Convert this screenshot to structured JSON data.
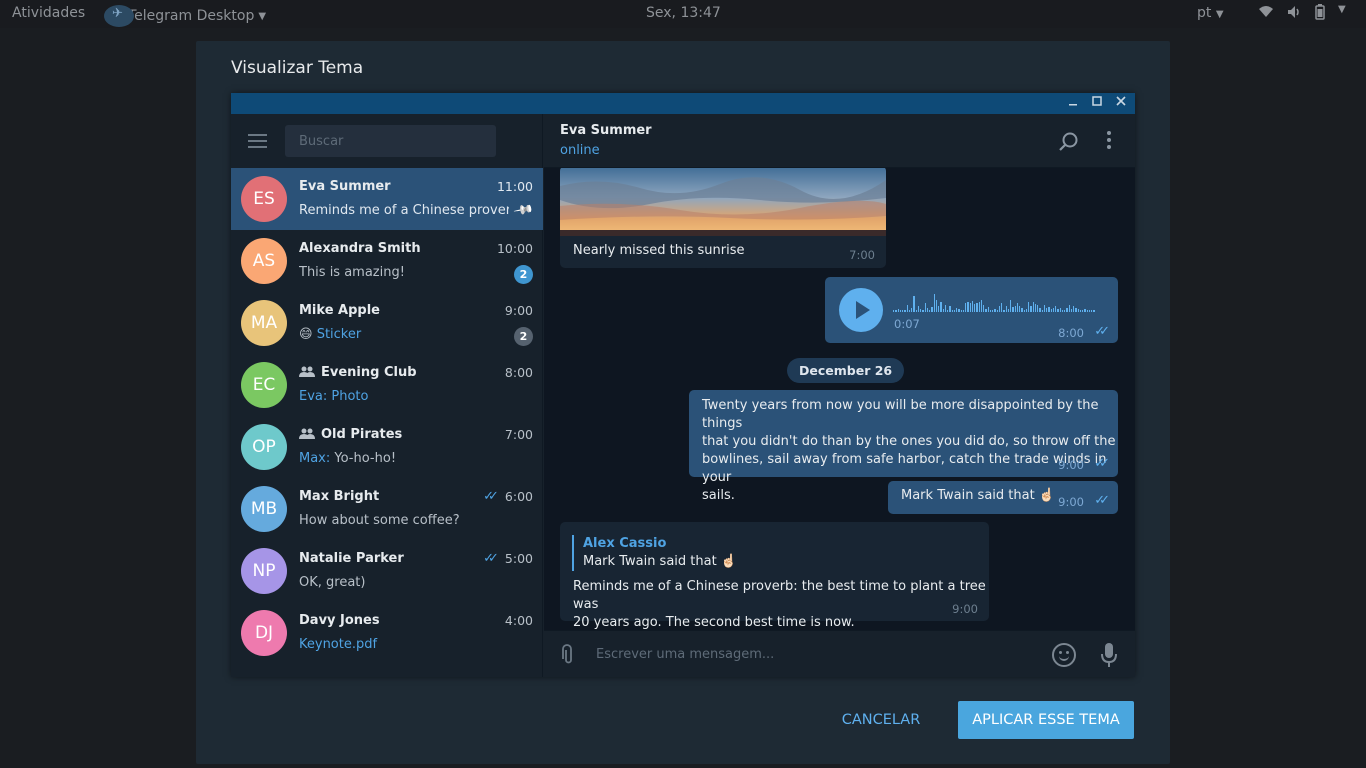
{
  "topbar": {
    "activities": "Atividades",
    "app_name": "Telegram Desktop",
    "clock": "Sex, 13:47",
    "lang": "pt"
  },
  "dialog": {
    "title": "Visualizar Tema",
    "cancel": "CANCELAR",
    "apply": "APLICAR ESSE TEMA"
  },
  "preview": {
    "search_placeholder": "Buscar",
    "chats": [
      {
        "initials": "ES",
        "name": "Eva Summer",
        "time": "11:00",
        "preview": "Reminds me of a Chinese proverb...",
        "color": "#e17076",
        "pinned": true
      },
      {
        "initials": "AS",
        "name": "Alexandra Smith",
        "time": "10:00",
        "preview": "This is amazing!",
        "color": "#faa774",
        "badge": "2",
        "badge_color": "#3f96d0"
      },
      {
        "initials": "MA",
        "name": "Mike Apple",
        "time": "9:00",
        "emoji": "😄",
        "preview_hl": "Sticker",
        "color": "#e8c47a",
        "badge": "2",
        "badge_color": "#56626f"
      },
      {
        "initials": "EC",
        "name": "Evening Club",
        "group": true,
        "time": "8:00",
        "preview_hl": "Eva: Photo",
        "color": "#7bc862"
      },
      {
        "initials": "OP",
        "name": "Old Pirates",
        "group": true,
        "time": "7:00",
        "preview_hl": "Max:",
        "preview": " Yo-ho-ho!",
        "color": "#6ec9cb"
      },
      {
        "initials": "MB",
        "name": "Max Bright",
        "time": "6:00",
        "read": true,
        "preview": "How about some coffee?",
        "color": "#65aadd"
      },
      {
        "initials": "NP",
        "name": "Natalie Parker",
        "time": "5:00",
        "read": true,
        "preview": "OK, great)",
        "color": "#a695e7"
      },
      {
        "initials": "DJ",
        "name": "Davy Jones",
        "time": "4:00",
        "preview_hl": "Keynote.pdf",
        "color": "#ee7aae"
      }
    ],
    "peer": {
      "name": "Eva Summer",
      "status": "online"
    },
    "messages": {
      "photo_caption": "Nearly missed this sunrise",
      "photo_time": "7:00",
      "voice_duration": "0:07",
      "voice_time": "8:00",
      "voice_levels": [
        0.1,
        0.1,
        0.15,
        0.1,
        0.1,
        0.1,
        0.35,
        0.1,
        0.2,
        0.8,
        0.1,
        0.3,
        0.15,
        0.1,
        0.45,
        0.2,
        0.1,
        0.25,
        0.9,
        0.6,
        0.3,
        0.5,
        0.15,
        0.35,
        0.1,
        0.3,
        0.1,
        0.1,
        0.2,
        0.15,
        0.1,
        0.1,
        0.45,
        0.5,
        0.45,
        0.55,
        0.4,
        0.45,
        0.5,
        0.6,
        0.35,
        0.15,
        0.25,
        0.1,
        0.1,
        0.15,
        0.1,
        0.3,
        0.45,
        0.1,
        0.3,
        0.15,
        0.6,
        0.25,
        0.3,
        0.45,
        0.3,
        0.2,
        0.1,
        0.15,
        0.5,
        0.3,
        0.5,
        0.4,
        0.35,
        0.2,
        0.1,
        0.35,
        0.2,
        0.25,
        0.15,
        0.2,
        0.3,
        0.15,
        0.2,
        0.1,
        0.1,
        0.2,
        0.35,
        0.15,
        0.3,
        0.2,
        0.15,
        0.1,
        0.1,
        0.15,
        0.1,
        0.1,
        0.1,
        0.1
      ],
      "voice_played": 0,
      "date": "December 26",
      "quote_lines": [
        "Twenty years from now you will be more disappointed by the things",
        "that you didn't do than by the ones you did do, so throw off the",
        "bowlines, sail away from safe harbor, catch the trade winds in your",
        "sails."
      ],
      "quote_time": "9:00",
      "twain": "Mark Twain said that ☝🏻",
      "twain_time": "9:00",
      "reply_name": "Alex Cassio",
      "reply_text": "Mark Twain said that ☝🏻",
      "reply_body_lines": [
        "Reminds me of a Chinese proverb: the best time to plant a tree was",
        "20 years ago. The second best time is now."
      ],
      "reply_time": "9:00"
    },
    "composer_placeholder": "Escrever uma mensagem..."
  },
  "colors": {
    "accent": "#4fa3e3",
    "active_chat": "#2b5278",
    "out_bubble": "#2b5278",
    "in_bubble": "#182533",
    "titlebar": "#0e4a77"
  }
}
